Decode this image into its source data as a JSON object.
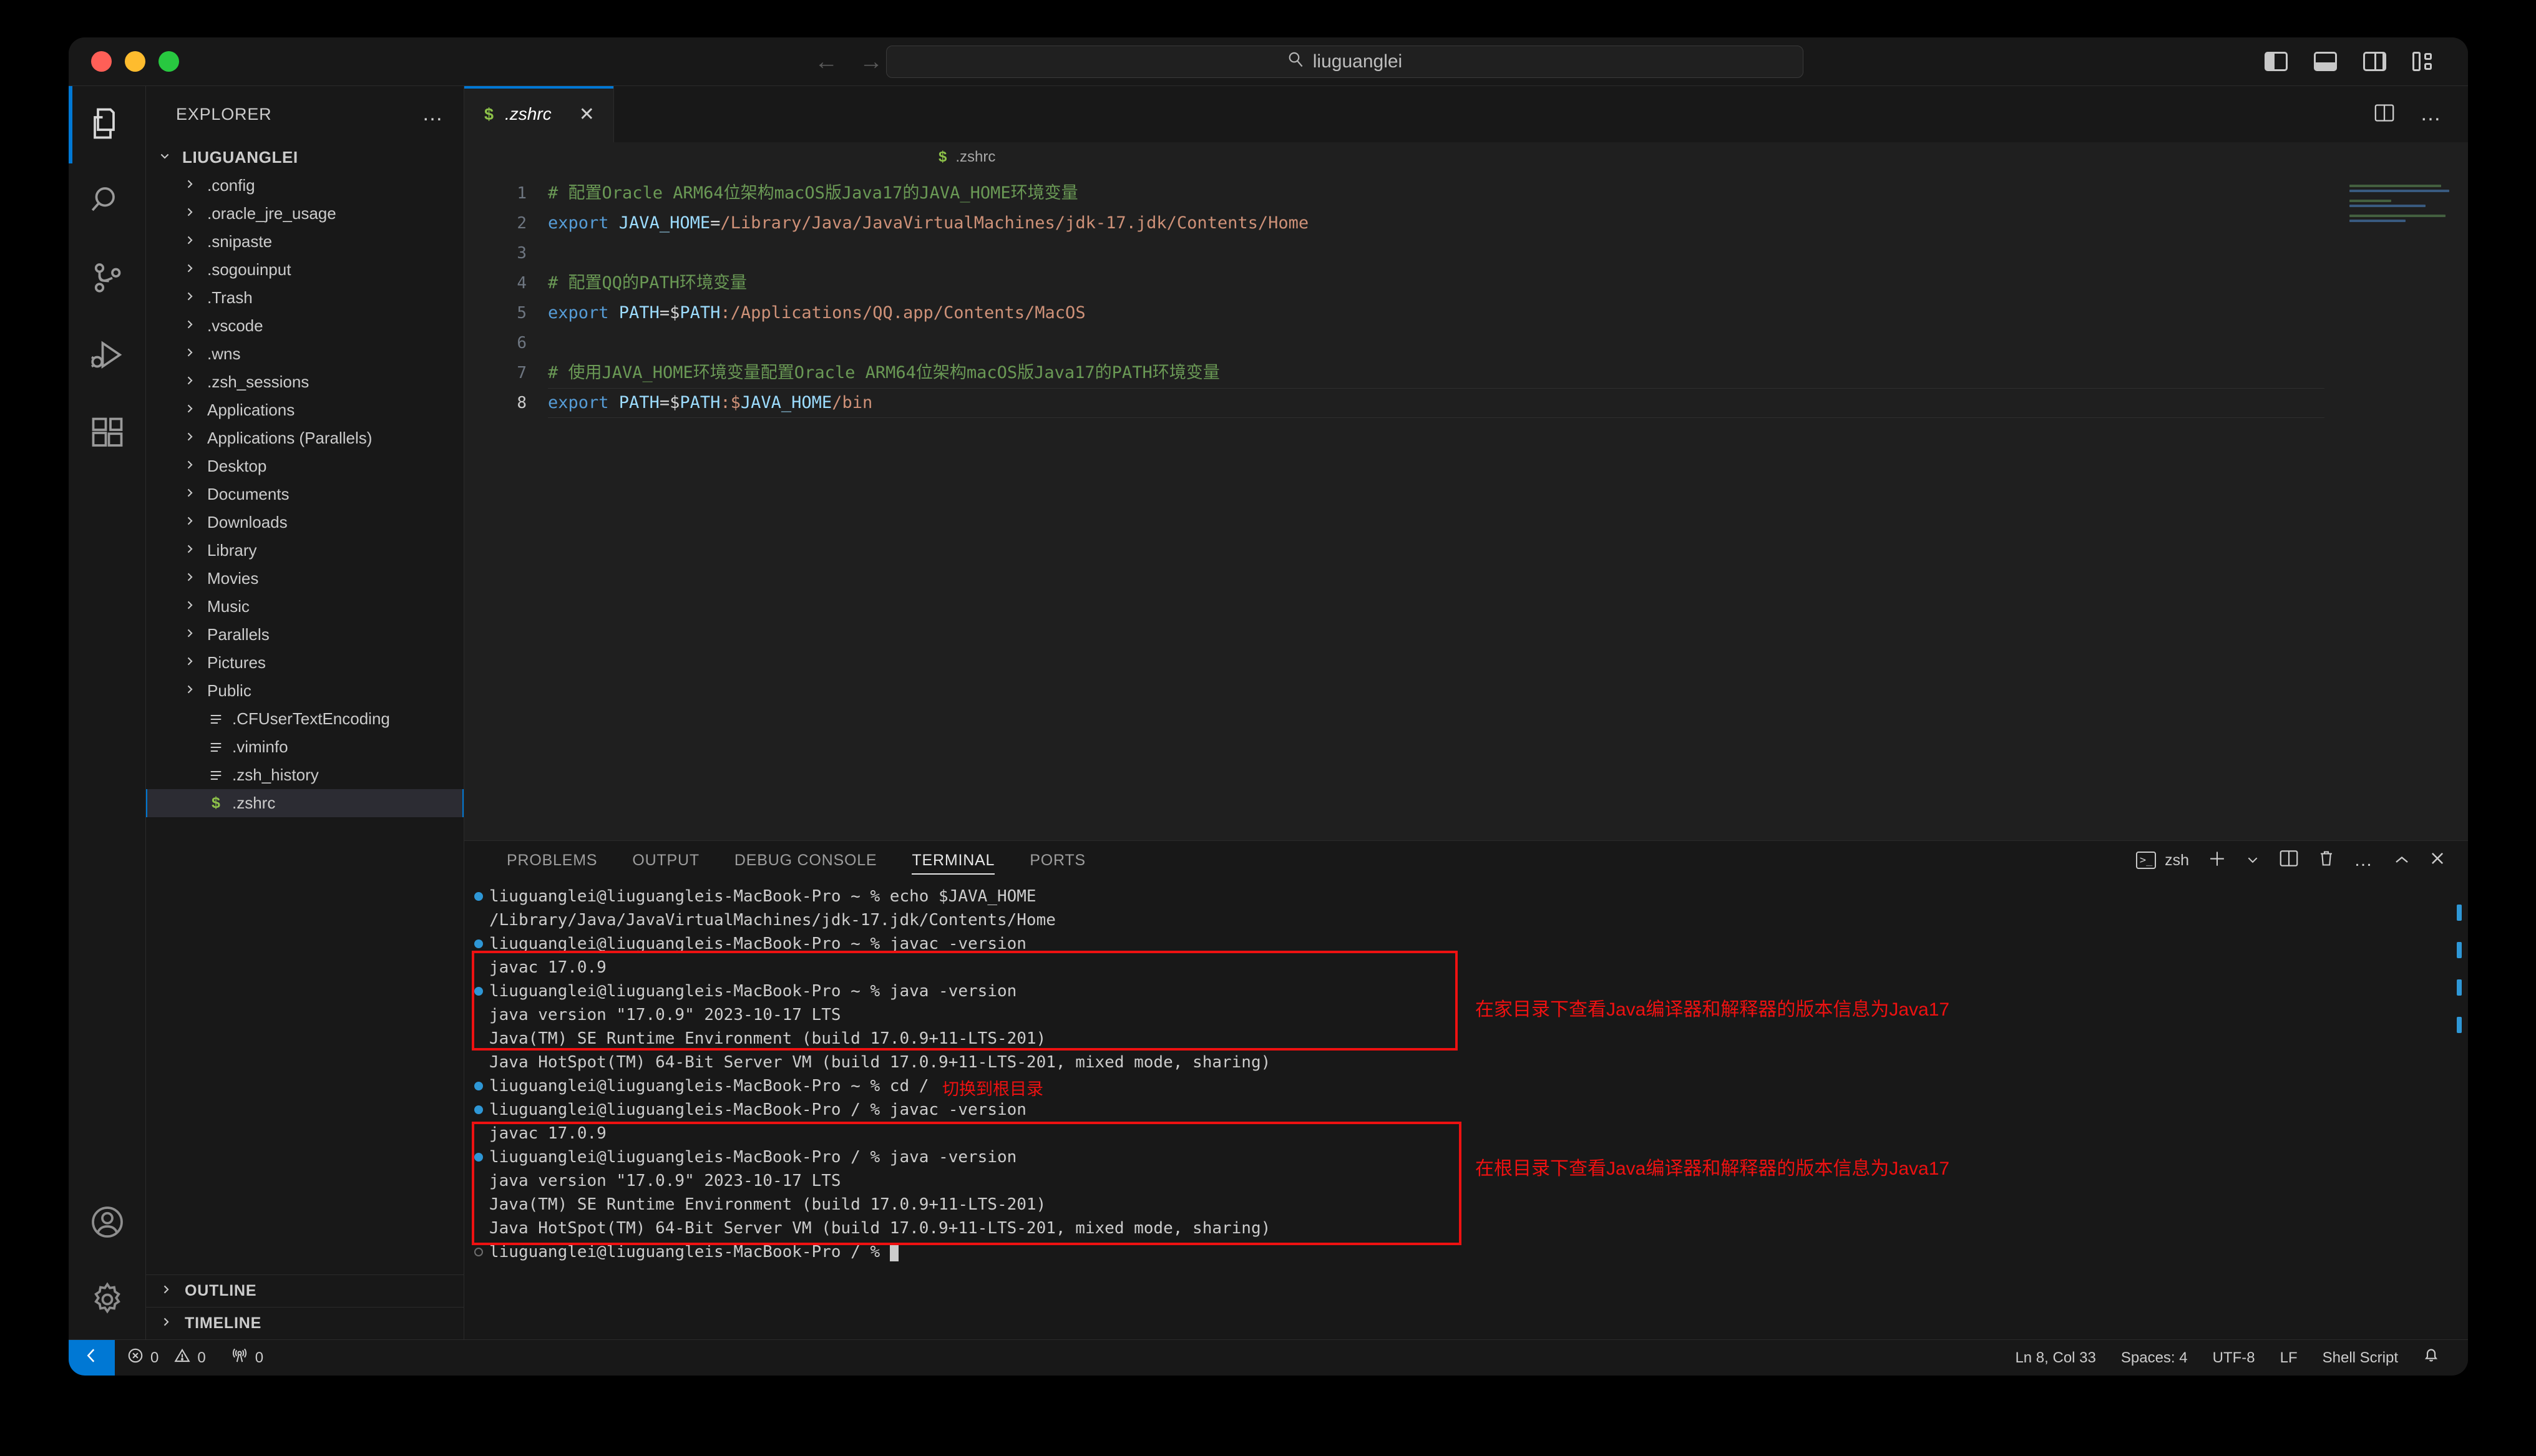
{
  "titlebar": {
    "search_value": "liuguanglei",
    "search_icon": "search-icon",
    "back_arrow": "←",
    "forward_arrow": "→",
    "layout_icons": [
      "toggle-primary-sidebar",
      "toggle-panel",
      "toggle-secondary-sidebar",
      "customize-layout"
    ]
  },
  "activitybar": {
    "items": [
      {
        "name": "explorer",
        "icon": "files-icon",
        "active": true
      },
      {
        "name": "search",
        "icon": "search-icon",
        "active": false
      },
      {
        "name": "source-control",
        "icon": "source-control-icon",
        "active": false
      },
      {
        "name": "run-and-debug",
        "icon": "run-debug-icon",
        "active": false
      },
      {
        "name": "extensions",
        "icon": "extensions-icon",
        "active": false
      }
    ],
    "bottom": [
      {
        "name": "accounts",
        "icon": "account-icon"
      },
      {
        "name": "manage",
        "icon": "gear-icon"
      }
    ]
  },
  "sidebar": {
    "title": "EXPLORER",
    "more_actions": "…",
    "root": "LIUGUANGLEI",
    "items": [
      {
        "label": ".config",
        "type": "folder"
      },
      {
        "label": ".oracle_jre_usage",
        "type": "folder"
      },
      {
        "label": ".snipaste",
        "type": "folder"
      },
      {
        "label": ".sogouinput",
        "type": "folder"
      },
      {
        "label": ".Trash",
        "type": "folder"
      },
      {
        "label": ".vscode",
        "type": "folder"
      },
      {
        "label": ".wns",
        "type": "folder"
      },
      {
        "label": ".zsh_sessions",
        "type": "folder"
      },
      {
        "label": "Applications",
        "type": "folder"
      },
      {
        "label": "Applications (Parallels)",
        "type": "folder"
      },
      {
        "label": "Desktop",
        "type": "folder"
      },
      {
        "label": "Documents",
        "type": "folder"
      },
      {
        "label": "Downloads",
        "type": "folder"
      },
      {
        "label": "Library",
        "type": "folder"
      },
      {
        "label": "Movies",
        "type": "folder"
      },
      {
        "label": "Music",
        "type": "folder"
      },
      {
        "label": "Parallels",
        "type": "folder"
      },
      {
        "label": "Pictures",
        "type": "folder"
      },
      {
        "label": "Public",
        "type": "folder"
      },
      {
        "label": ".CFUserTextEncoding",
        "type": "file"
      },
      {
        "label": ".viminfo",
        "type": "file"
      },
      {
        "label": ".zsh_history",
        "type": "file"
      },
      {
        "label": ".zshrc",
        "type": "shell",
        "selected": true
      }
    ],
    "sections": [
      {
        "label": "OUTLINE"
      },
      {
        "label": "TIMELINE"
      }
    ]
  },
  "editor": {
    "tab": {
      "label": ".zshrc",
      "icon": "shell-file-icon",
      "close": "✕"
    },
    "tab_actions": [
      "split-editor-icon",
      "more-actions-icon"
    ],
    "breadcrumb": {
      "icon": "shell-file-icon",
      "label": ".zshrc"
    },
    "lines": [
      {
        "n": 1,
        "tokens": [
          {
            "t": "# 配置Oracle ARM64位架构macOS版Java17的JAVA_HOME环境变量",
            "c": "c-com"
          }
        ]
      },
      {
        "n": 2,
        "tokens": [
          {
            "t": "export ",
            "c": "c-kw"
          },
          {
            "t": "JAVA_HOME",
            "c": "c-var"
          },
          {
            "t": "=",
            "c": "c-op"
          },
          {
            "t": "/Library/Java/JavaVirtualMachines/jdk-17.jdk/Contents/Home",
            "c": "c-str"
          }
        ]
      },
      {
        "n": 3,
        "tokens": []
      },
      {
        "n": 4,
        "tokens": [
          {
            "t": "# 配置QQ的PATH环境变量",
            "c": "c-com"
          }
        ]
      },
      {
        "n": 5,
        "tokens": [
          {
            "t": "export ",
            "c": "c-kw"
          },
          {
            "t": "PATH",
            "c": "c-var"
          },
          {
            "t": "=$",
            "c": "c-op"
          },
          {
            "t": "PATH",
            "c": "c-var"
          },
          {
            "t": ":/Applications/QQ.app/Contents/MacOS",
            "c": "c-str"
          }
        ]
      },
      {
        "n": 6,
        "tokens": []
      },
      {
        "n": 7,
        "tokens": [
          {
            "t": "# 使用JAVA_HOME环境变量配置Oracle ARM64位架构macOS版Java17的PATH环境变量",
            "c": "c-com"
          }
        ]
      },
      {
        "n": 8,
        "tokens": [
          {
            "t": "export ",
            "c": "c-kw"
          },
          {
            "t": "PATH",
            "c": "c-var"
          },
          {
            "t": "=$",
            "c": "c-op"
          },
          {
            "t": "PATH",
            "c": "c-var"
          },
          {
            "t": ":$",
            "c": "c-str"
          },
          {
            "t": "JAVA_HOME",
            "c": "c-var"
          },
          {
            "t": "/bin",
            "c": "c-str"
          }
        ],
        "current": true
      }
    ]
  },
  "panel": {
    "tabs": [
      {
        "label": "PROBLEMS",
        "active": false
      },
      {
        "label": "OUTPUT",
        "active": false
      },
      {
        "label": "DEBUG CONSOLE",
        "active": false
      },
      {
        "label": "TERMINAL",
        "active": true
      },
      {
        "label": "PORTS",
        "active": false
      }
    ],
    "shell_name": "zsh",
    "actions": [
      "new-terminal-icon",
      "chevron-down-icon",
      "split-terminal-icon",
      "kill-terminal-icon",
      "more-actions-icon",
      "maximize-panel-icon",
      "close-panel-icon"
    ],
    "terminal_lines": [
      {
        "text": "liuguanglei@liuguangleis-MacBook-Pro ~ % echo $JAVA_HOME",
        "mark": "blue"
      },
      {
        "text": "/Library/Java/JavaVirtualMachines/jdk-17.jdk/Contents/Home",
        "mark": "none"
      },
      {
        "text": "liuguanglei@liuguangleis-MacBook-Pro ~ % javac -version",
        "mark": "blue"
      },
      {
        "text": "javac 17.0.9",
        "mark": "none"
      },
      {
        "text": "liuguanglei@liuguangleis-MacBook-Pro ~ % java -version",
        "mark": "blue"
      },
      {
        "text": "java version \"17.0.9\" 2023-10-17 LTS",
        "mark": "none"
      },
      {
        "text": "Java(TM) SE Runtime Environment (build 17.0.9+11-LTS-201)",
        "mark": "none"
      },
      {
        "text": "Java HotSpot(TM) 64-Bit Server VM (build 17.0.9+11-LTS-201, mixed mode, sharing)",
        "mark": "none"
      },
      {
        "text": "liuguanglei@liuguangleis-MacBook-Pro ~ % cd /",
        "mark": "blue"
      },
      {
        "text": "liuguanglei@liuguangleis-MacBook-Pro / % javac -version",
        "mark": "blue"
      },
      {
        "text": "javac 17.0.9",
        "mark": "none"
      },
      {
        "text": "liuguanglei@liuguangleis-MacBook-Pro / % java -version",
        "mark": "blue"
      },
      {
        "text": "java version \"17.0.9\" 2023-10-17 LTS",
        "mark": "none"
      },
      {
        "text": "Java(TM) SE Runtime Environment (build 17.0.9+11-LTS-201)",
        "mark": "none"
      },
      {
        "text": "Java HotSpot(TM) 64-Bit Server VM (build 17.0.9+11-LTS-201, mixed mode, sharing)",
        "mark": "none"
      },
      {
        "text": "liuguanglei@liuguangleis-MacBook-Pro / % ",
        "mark": "hollow"
      }
    ],
    "annotations": [
      {
        "text": "切换到根目录",
        "kind": "inline"
      },
      {
        "text": "在家目录下查看Java编译器和解释器的版本信息为Java17",
        "kind": "right"
      },
      {
        "text": "在根目录下查看Java编译器和解释器的版本信息为Java17",
        "kind": "right"
      }
    ],
    "highlight_color": "#ee1111"
  },
  "statusbar": {
    "remote_icon": "remote-window-icon",
    "errors_icon": "error-icon",
    "errors": "0",
    "warnings_icon": "warning-icon",
    "warnings": "0",
    "ports_icon": "radio-tower-icon",
    "ports": "0",
    "cursor_position": "Ln 8, Col 33",
    "indentation": "Spaces: 4",
    "encoding": "UTF-8",
    "eol": "LF",
    "language": "Shell Script",
    "bell_icon": "bell-icon"
  }
}
